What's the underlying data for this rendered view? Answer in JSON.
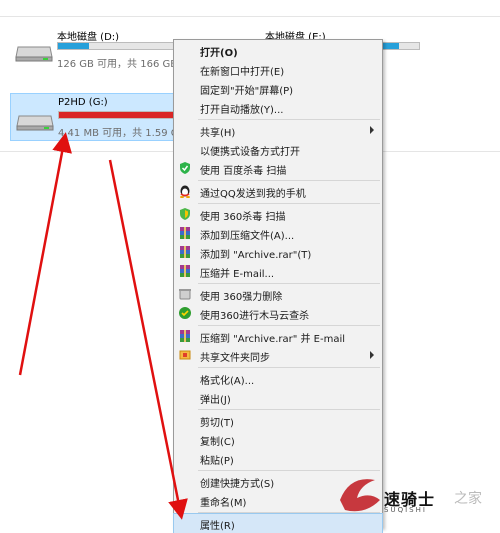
{
  "drives": {
    "d": {
      "name": "本地磁盘 (D:)",
      "info": "126 GB 可用，共 166 GB",
      "fill_fraction": 0.24,
      "bar_color": "#26a0da"
    },
    "e": {
      "name": "本地磁盘 (E:)",
      "fill_fraction": 0.45,
      "bar_color": "#26a0da"
    },
    "g": {
      "name": "P2HD (G:)",
      "info": "4.41 MB 可用，共 1.59 G",
      "fill_fraction": 0.99,
      "bar_color": "#da2626"
    }
  },
  "menu": {
    "items": [
      {
        "label": "打开(O)",
        "bold": true
      },
      {
        "label": "在新窗口中打开(E)"
      },
      {
        "label": "固定到\"开始\"屏幕(P)"
      },
      {
        "label": "打开自动播放(Y)..."
      },
      {
        "label": "共享(H)",
        "submenu": true
      },
      {
        "label": "以便携式设备方式打开"
      },
      {
        "label": "使用 百度杀毒 扫描",
        "icon": "baidu-shield-icon"
      },
      {
        "label": "通过QQ发送到我的手机",
        "icon": "qq-penguin-icon"
      },
      {
        "label": "使用 360杀毒 扫描",
        "icon": "360-shield-icon"
      },
      {
        "label": "添加到压缩文件(A)...",
        "icon": "winrar-icon"
      },
      {
        "label": "添加到 \"Archive.rar\"(T)",
        "icon": "winrar-icon"
      },
      {
        "label": "压缩并 E-mail...",
        "icon": "winrar-icon"
      },
      {
        "label": "使用 360强力删除",
        "icon": "360-delete-icon"
      },
      {
        "label": "使用360进行木马云查杀",
        "icon": "360-trojan-icon"
      },
      {
        "label": "压缩到 \"Archive.rar\" 并 E-mail",
        "icon": "winrar-icon"
      },
      {
        "label": "共享文件夹同步",
        "icon": "folder-sync-icon",
        "submenu": true
      },
      {
        "label": "格式化(A)..."
      },
      {
        "label": "弹出(J)"
      },
      {
        "label": "剪切(T)"
      },
      {
        "label": "复制(C)"
      },
      {
        "label": "粘贴(P)"
      },
      {
        "label": "创建快捷方式(S)"
      },
      {
        "label": "重命名(M)"
      },
      {
        "label": "属性(R)"
      }
    ]
  },
  "colors": {
    "annotation_arrow": "#e01010",
    "selection": "#cce8ff"
  },
  "watermark": {
    "text": "速骑士",
    "sub": "SUQISHI",
    "suffix": "之家"
  }
}
